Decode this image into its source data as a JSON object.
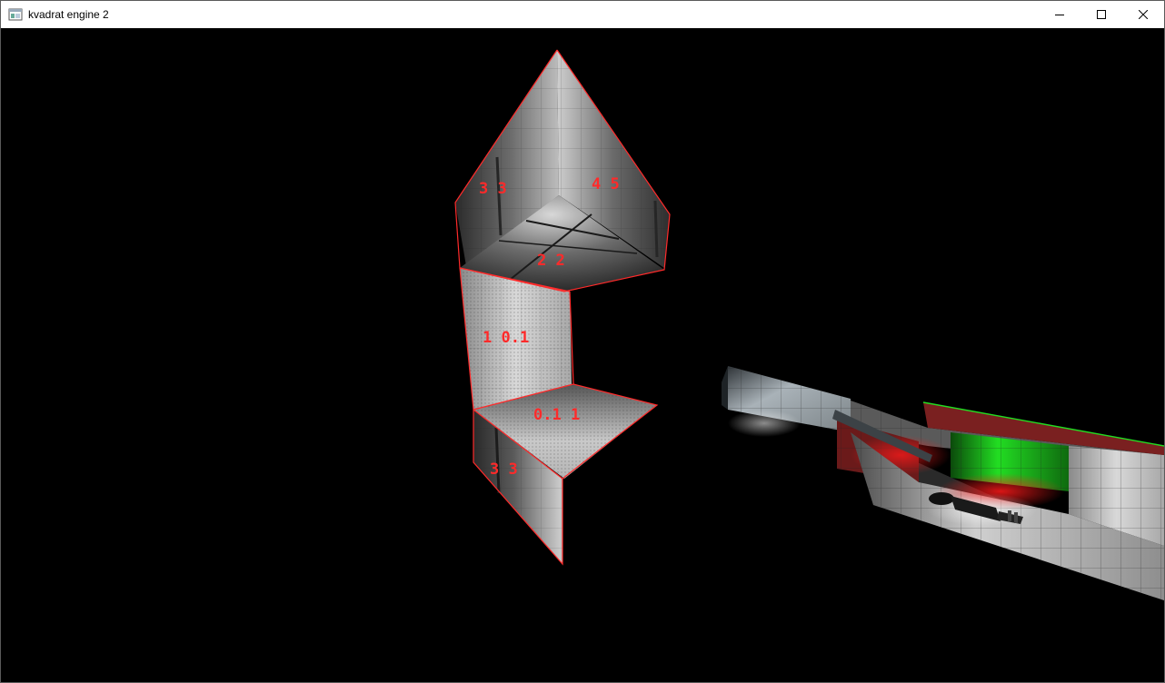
{
  "window": {
    "title": "kvadrat engine 2",
    "icon": "app-window-icon",
    "controls": [
      "minimize-icon",
      "maximize-icon",
      "close-icon"
    ]
  },
  "scene": {
    "face_labels": [
      "3 3",
      "4 5",
      "2 2",
      "1 0.1",
      "0.1 1",
      "3 3"
    ],
    "colors": {
      "background": "#000000",
      "edge": "#ff2a2a",
      "label": "#ff2a2a",
      "green_light": "#22dd22",
      "red_light": "#ff1a1a"
    }
  }
}
